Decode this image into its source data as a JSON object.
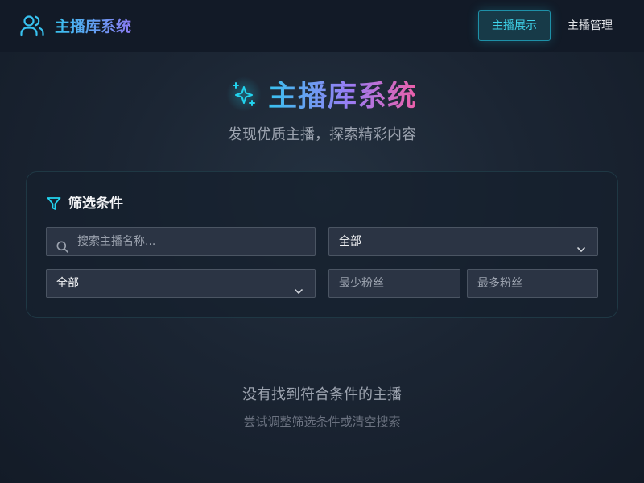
{
  "header": {
    "brand_icon": "users-icon",
    "brand_name": "主播库系统",
    "nav": [
      {
        "label": "主播展示",
        "active": true
      },
      {
        "label": "主播管理",
        "active": false
      }
    ]
  },
  "hero": {
    "icon": "sparkles-icon",
    "title": "主播库系统",
    "subtitle": "发现优质主播，探索精彩内容"
  },
  "filters": {
    "icon": "filter-icon",
    "title": "筛选条件",
    "search": {
      "value": "",
      "placeholder": "搜索主播名称..."
    },
    "select_a": {
      "selected": "全部"
    },
    "select_b": {
      "selected": "全部"
    },
    "min_followers": {
      "value": "",
      "placeholder": "最少粉丝"
    },
    "max_followers": {
      "value": "",
      "placeholder": "最多粉丝"
    }
  },
  "empty_state": {
    "title": "没有找到符合条件的主播",
    "hint": "尝试调整筛选条件或清空搜索"
  },
  "colors": {
    "accent": "#22d3ee",
    "gradient": [
      "#38c2f0",
      "#9b7cf4",
      "#ec5fa8"
    ],
    "background": "#1b2533"
  }
}
